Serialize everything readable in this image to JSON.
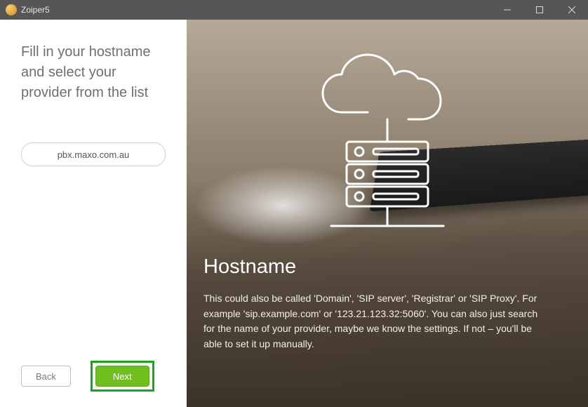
{
  "window": {
    "title": "Zoiper5"
  },
  "left": {
    "heading": "Fill in your hostname and select your provider from the list",
    "hostname_value": "pbx.maxo.com.au",
    "back_label": "Back",
    "next_label": "Next"
  },
  "right": {
    "title": "Hostname",
    "body": "This could also be called 'Domain', 'SIP server', 'Registrar' or 'SIP Proxy'. For example 'sip.example.com' or '123.21.123.32:5060'. You can also just search for the name of your provider, maybe we know the settings. If not – you'll be able to set it up manually."
  }
}
